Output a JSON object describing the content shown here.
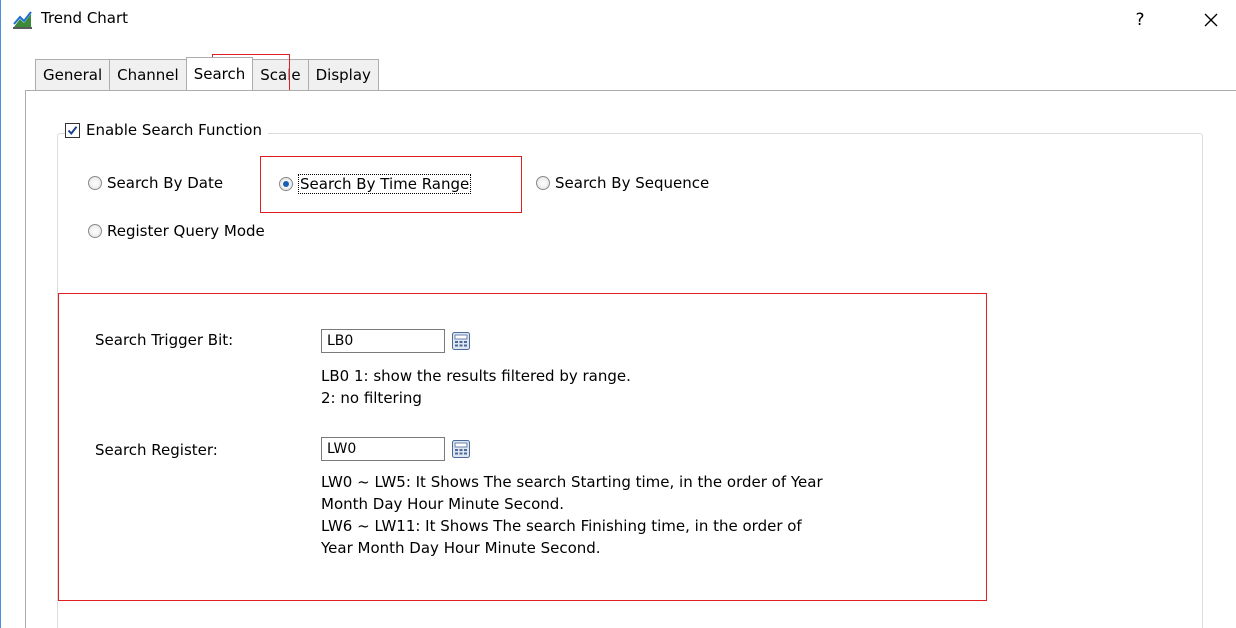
{
  "window": {
    "title": "Trend Chart",
    "help_label": "?"
  },
  "tabs": [
    {
      "label": "General"
    },
    {
      "label": "Channel"
    },
    {
      "label": "Search"
    },
    {
      "label": "Scale"
    },
    {
      "label": "Display"
    }
  ],
  "active_tab": "Search",
  "search": {
    "enable_label": "Enable Search Function",
    "enable_checked": true,
    "modes": [
      {
        "label": "Search By Date",
        "checked": false
      },
      {
        "label": "Search By Time Range",
        "checked": true
      },
      {
        "label": "Search By Sequence",
        "checked": false
      },
      {
        "label": "Register Query Mode",
        "checked": false
      }
    ],
    "trigger_bit": {
      "label": "Search Trigger Bit:",
      "value": "LB0",
      "desc_line1": "LB0 1: show the results filtered by range.",
      "desc_line2": "2: no filtering"
    },
    "register": {
      "label": "Search Register:",
      "value": "LW0",
      "desc_line1": "LW0 ~ LW5: It Shows The search Starting time, in the order of Year",
      "desc_line2": "Month Day Hour Minute Second.",
      "desc_line3": "LW6 ~ LW11: It Shows The search Finishing time, in the order of",
      "desc_line4": "Year Month Day Hour Minute Second."
    }
  },
  "colors": {
    "highlight": "#e02020",
    "radio_selected": "#1a5fb4"
  }
}
